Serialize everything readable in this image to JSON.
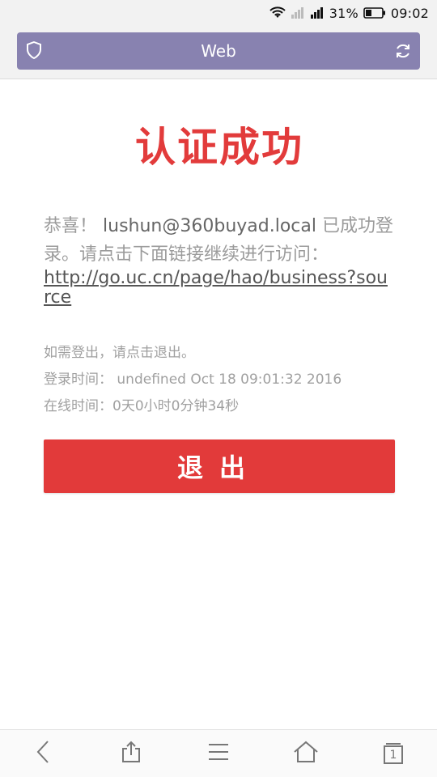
{
  "status_bar": {
    "battery_percent": "31%",
    "time": "09:02"
  },
  "browser": {
    "url_title": "Web",
    "bottom_nav": {
      "tab_count": "1"
    }
  },
  "page": {
    "title": "认证成功",
    "welcome_prefix": "恭喜！",
    "username": "lushun@360buyad.local",
    "welcome_suffix": "已成功登录。请点击下面链接继续进行访问：",
    "link_url": "http://go.uc.cn/page/hao/business?source",
    "logout_hint": "如需登出，请点击退出。",
    "login_time_label": "登录时间：",
    "login_time_value": "undefined Oct 18 09:01:32 2016",
    "online_time_label": "在线时间：",
    "online_time_value": "0天0小时0分钟34秒",
    "logout_button_label": "退出"
  }
}
